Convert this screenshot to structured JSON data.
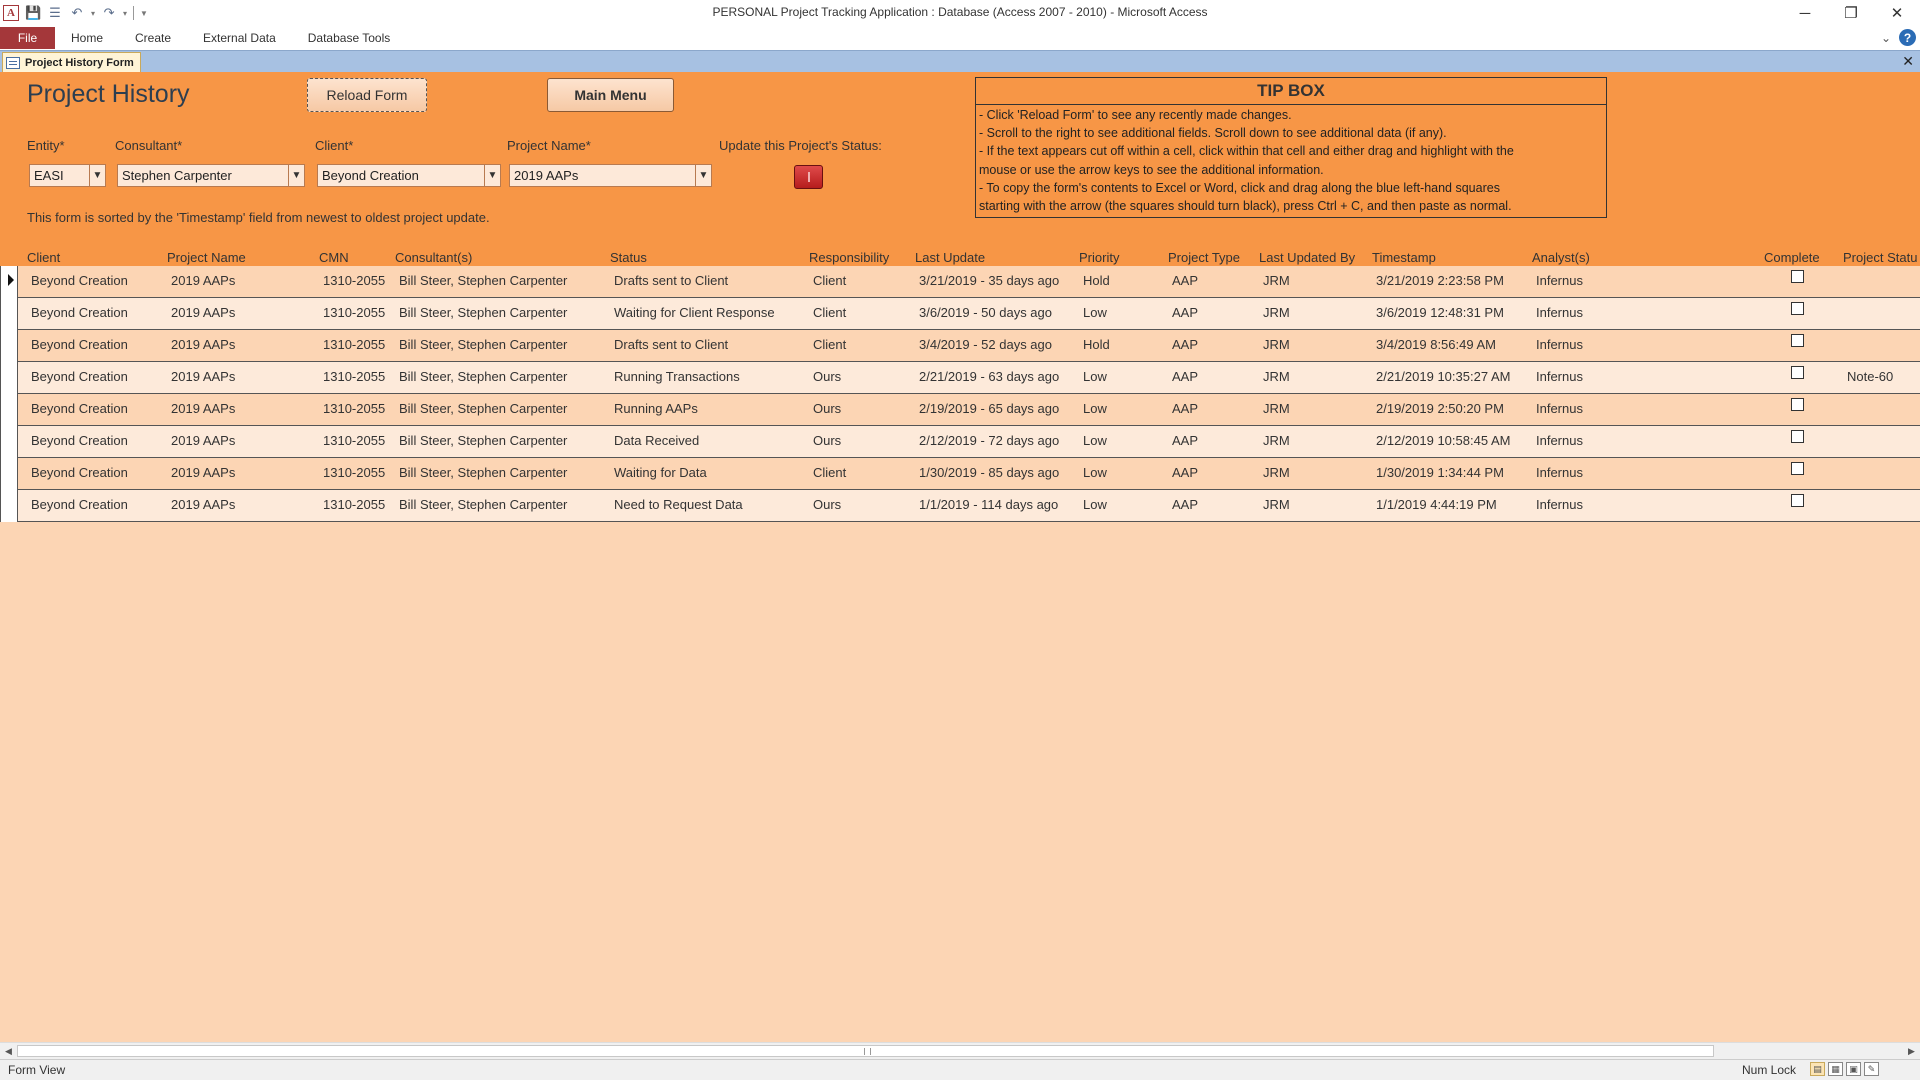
{
  "window": {
    "title": "PERSONAL Project Tracking Application : Database (Access 2007 - 2010)  -  Microsoft Access",
    "minimize": "─",
    "restore": "❐",
    "close": "✕"
  },
  "ribbon": {
    "tabs": [
      "File",
      "Home",
      "Create",
      "External Data",
      "Database Tools"
    ]
  },
  "doc_tab": {
    "label": "Project History Form",
    "close": "✕"
  },
  "form": {
    "title": "Project History",
    "reload_label": "Reload Form",
    "main_menu_label": "Main Menu",
    "labels": {
      "entity": "Entity*",
      "consultant": "Consultant*",
      "client": "Client*",
      "project_name": "Project Name*",
      "update_status": "Update this Project's Status:"
    },
    "values": {
      "entity": "EASI",
      "consultant": "Stephen Carpenter",
      "client": "Beyond Creation",
      "project_name": "2019 AAPs"
    },
    "sort_note": "This form is sorted by the 'Timestamp' field from newest to oldest project update."
  },
  "tipbox": {
    "title": "TIP BOX",
    "lines": [
      "- Click 'Reload Form' to see any recently made changes.",
      "- Scroll to the right to see additional fields. Scroll down to see additional data (if any).",
      "- If the text appears cut off within a cell, click within that cell and either drag and highlight with the",
      "mouse or use the arrow keys to see the additional information.",
      "- To copy the form's contents to Excel or Word, click and drag along the blue left-hand squares",
      "starting with the arrow (the squares should turn black), press Ctrl + C, and then paste as normal."
    ]
  },
  "columns": [
    "Client",
    "Project Name",
    "CMN",
    "Consultant(s)",
    "Status",
    "Responsibility",
    "Last Update",
    "Priority",
    "Project Type",
    "Last Updated By",
    "Timestamp",
    "Analyst(s)",
    "Complete",
    "Project Statu"
  ],
  "rows": [
    [
      "Beyond Creation",
      "2019 AAPs",
      "1310-2055",
      "Bill Steer, Stephen Carpenter",
      "Drafts sent to Client",
      "Client",
      "3/21/2019 - 35 days ago",
      "Hold",
      "AAP",
      "JRM",
      "3/21/2019 2:23:58 PM",
      "Infernus",
      ""
    ],
    [
      "Beyond Creation",
      "2019 AAPs",
      "1310-2055",
      "Bill Steer, Stephen Carpenter",
      "Waiting for Client Response",
      "Client",
      "3/6/2019 - 50 days ago",
      "Low",
      "AAP",
      "JRM",
      "3/6/2019 12:48:31 PM",
      "Infernus",
      ""
    ],
    [
      "Beyond Creation",
      "2019 AAPs",
      "1310-2055",
      "Bill Steer, Stephen Carpenter",
      "Drafts sent to Client",
      "Client",
      "3/4/2019 - 52 days ago",
      "Hold",
      "AAP",
      "JRM",
      "3/4/2019 8:56:49 AM",
      "Infernus",
      ""
    ],
    [
      "Beyond Creation",
      "2019 AAPs",
      "1310-2055",
      "Bill Steer, Stephen Carpenter",
      "Running Transactions",
      "Ours",
      "2/21/2019 - 63 days ago",
      "Low",
      "AAP",
      "JRM",
      "2/21/2019 10:35:27 AM",
      "Infernus",
      "Note-60"
    ],
    [
      "Beyond Creation",
      "2019 AAPs",
      "1310-2055",
      "Bill Steer, Stephen Carpenter",
      "Running AAPs",
      "Ours",
      "2/19/2019 - 65 days ago",
      "Low",
      "AAP",
      "JRM",
      "2/19/2019 2:50:20 PM",
      "Infernus",
      ""
    ],
    [
      "Beyond Creation",
      "2019 AAPs",
      "1310-2055",
      "Bill Steer, Stephen Carpenter",
      "Data Received",
      "Ours",
      "2/12/2019 - 72 days ago",
      "Low",
      "AAP",
      "JRM",
      "2/12/2019 10:58:45 AM",
      "Infernus",
      ""
    ],
    [
      "Beyond Creation",
      "2019 AAPs",
      "1310-2055",
      "Bill Steer, Stephen Carpenter",
      "Waiting for Data",
      "Client",
      "1/30/2019 - 85 days ago",
      "Low",
      "AAP",
      "JRM",
      "1/30/2019 1:34:44 PM",
      "Infernus",
      ""
    ],
    [
      "Beyond Creation",
      "2019 AAPs",
      "1310-2055",
      "Bill Steer, Stephen Carpenter",
      "Need to Request Data",
      "Ours",
      "1/1/2019 - 114 days ago",
      "Low",
      "AAP",
      "JRM",
      "1/1/2019 4:44:19 PM",
      "Infernus",
      ""
    ]
  ],
  "status_bar": {
    "view": "Form View",
    "num_lock": "Num Lock"
  },
  "colors": {
    "header_orange": "#f79646",
    "row_light": "#fdeada",
    "row_dark": "#fcd5b4",
    "file_tab": "#a4373a"
  }
}
